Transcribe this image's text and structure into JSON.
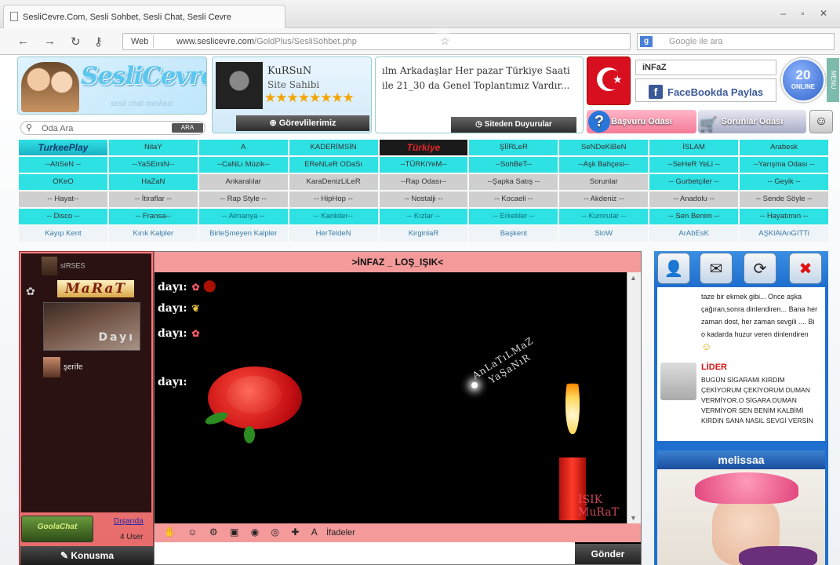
{
  "browser": {
    "tab_title": "SesliCevre.Com, Sesli Sohbet, Sesli Chat, Sesli Cevre",
    "window_buttons": "– ▫ ✕",
    "web_label": "Web",
    "url_host": "www.seslicevre.com",
    "url_path": "/GoldPlus/SesliSohbet.php",
    "search_placeholder": "Google ile ara"
  },
  "header": {
    "logo_text": "SesliCevre",
    "logo_slogan": "sesli chat merkezi",
    "room_search_placeholder": "Oda Ara",
    "room_search_button": "ARA",
    "owner_name": "KuRSuN",
    "owner_role": "Site Sahibi",
    "owner_stars": "★★★★★★★★",
    "staff_button": "Görevlilerimiz",
    "announcement": "ılm Arkadaşlar Her pazar Türkiye Saati ile 21_30 da Genel Toplantımız Vardır...",
    "announcements_button": "Siteden Duyurular",
    "username": "iNFaZ",
    "facebook_share": "FaceBookda Paylas",
    "online_count": "20",
    "online_label": "ONLINE",
    "menu_label": "MENU",
    "complaint_room": "Başvuru Odası",
    "problems_room": "Sorunlar Odası"
  },
  "rooms": [
    [
      {
        "l": "TurkeePlay",
        "s": "lg"
      },
      {
        "l": "NilaY",
        "s": "cy"
      },
      {
        "l": "A",
        "s": "cy"
      },
      {
        "l": "KADERİMSİN",
        "s": "cy"
      },
      {
        "l": "Türkiye",
        "s": "bk"
      },
      {
        "l": "ŞİİRLeR",
        "s": "cy"
      },
      {
        "l": "SeNDeKiBeN",
        "s": "cy"
      },
      {
        "l": "İSLAM",
        "s": "cy"
      },
      {
        "l": "Arabesk",
        "s": "cy"
      }
    ],
    [
      {
        "l": "--AhSeN --",
        "s": "cy"
      },
      {
        "l": "--YaSEmiN--",
        "s": "cy"
      },
      {
        "l": "--CaNLı Müzik--",
        "s": "cy"
      },
      {
        "l": "EReNLeR ODaSı",
        "s": "cy"
      },
      {
        "l": "--TÜRKiYeM--",
        "s": "cy"
      },
      {
        "l": "--SohBeT--",
        "s": "cy"
      },
      {
        "l": "--Aşk Bahçesi--",
        "s": "cy"
      },
      {
        "l": "--SeHeR YeLi --",
        "s": "cy"
      },
      {
        "l": "--Yarışma Odası --",
        "s": "cy"
      }
    ],
    [
      {
        "l": "OKeO",
        "s": "cy"
      },
      {
        "l": "HaZaN",
        "s": "cy"
      },
      {
        "l": "Ankaralılar",
        "s": "gy"
      },
      {
        "l": "KaraDenizLiLeR",
        "s": "gy"
      },
      {
        "l": "--Rap Odası--",
        "s": "gy"
      },
      {
        "l": "--Şapka Satış --",
        "s": "gy"
      },
      {
        "l": "Sorunlar",
        "s": "gy"
      },
      {
        "l": "-- Gurbetçiler --",
        "s": "cy"
      },
      {
        "l": "-- Geyik --",
        "s": "cy"
      }
    ],
    [
      {
        "l": "-- Hayat--",
        "s": "gy"
      },
      {
        "l": "-- İtiraflar --",
        "s": "gy"
      },
      {
        "l": "-- Rap Style --",
        "s": "gy"
      },
      {
        "l": "-- HipHop --",
        "s": "gy"
      },
      {
        "l": "-- Nostalji --",
        "s": "gy"
      },
      {
        "l": "-- Kocaeli --",
        "s": "gy"
      },
      {
        "l": "-- Akdeniz --",
        "s": "gy"
      },
      {
        "l": "-- Anadolu --",
        "s": "gy"
      },
      {
        "l": "-- Sende Söyle --",
        "s": "gy"
      }
    ],
    [
      {
        "l": "-- Disco --",
        "s": "cy"
      },
      {
        "l": "-- Fransa--",
        "s": "cy"
      },
      {
        "l": "-- Almanya --",
        "s": "cyt"
      },
      {
        "l": "-- Kankiler--",
        "s": "cyt"
      },
      {
        "l": "-- Kızlar --",
        "s": "cyt"
      },
      {
        "l": "-- Erkekler --",
        "s": "cyt"
      },
      {
        "l": "-- Kumrular --",
        "s": "cyt"
      },
      {
        "l": "-- Sen Benim --",
        "s": "cy"
      },
      {
        "l": "-- Hayatımın --",
        "s": "cy"
      }
    ],
    [
      {
        "l": "Kayıp Kent",
        "s": "wh"
      },
      {
        "l": "Kırık Kalpler",
        "s": "wh"
      },
      {
        "l": "BirleŞmeyen Kalpler",
        "s": "wh"
      },
      {
        "l": "HerTeldeN",
        "s": "wh"
      },
      {
        "l": "KirginlaR",
        "s": "wh"
      },
      {
        "l": "Başkent",
        "s": "wh"
      },
      {
        "l": "SloW",
        "s": "wh"
      },
      {
        "l": "ArAbEsK",
        "s": "wh"
      },
      {
        "l": "AŞKlAlAnGITTi",
        "s": "wh"
      }
    ]
  ],
  "left": {
    "user1": "sIRSES",
    "user_marat": "MaRaT",
    "avatar_caption": "Dayı",
    "user2": "şerife",
    "gc_label": "GoolaChat",
    "outside_link": "Dışarıda",
    "user_count": "4 User",
    "talk_button": "Konusma"
  },
  "chat": {
    "room_title": ">İNFAZ _ LOŞ_IŞIK<",
    "messages": [
      "dayı:",
      "dayı:",
      "dayı:",
      "dayı:"
    ],
    "overlay_line1": "AnLaTıLMaZ",
    "overlay_line2": "YaŞaNıR",
    "sig_line1": "IŞIK",
    "sig_line2": "MuRaT",
    "emoji_label": "İfadeler",
    "send_button": "Gönder"
  },
  "right": {
    "quote1": "taze bir ekmek gibi... Once aşka çağıran,sonra dinlendiren... Bana her zaman dost, her zaman sevgili .... Bi o kadarda huzur veren dinlendiren",
    "lider_label": "LİDER",
    "quote2": "BUGÜN SİGARAMI KIRDIM ÇEKİYORUM ÇEKİYORUM DUMAN VERMİYOR.O SİGARA DUMAN VERMİYOR SEN BENİM KALBİMİ KIRDIN SANA NASIL SEVGİ VERSİN",
    "featured_user": "melissaa"
  }
}
